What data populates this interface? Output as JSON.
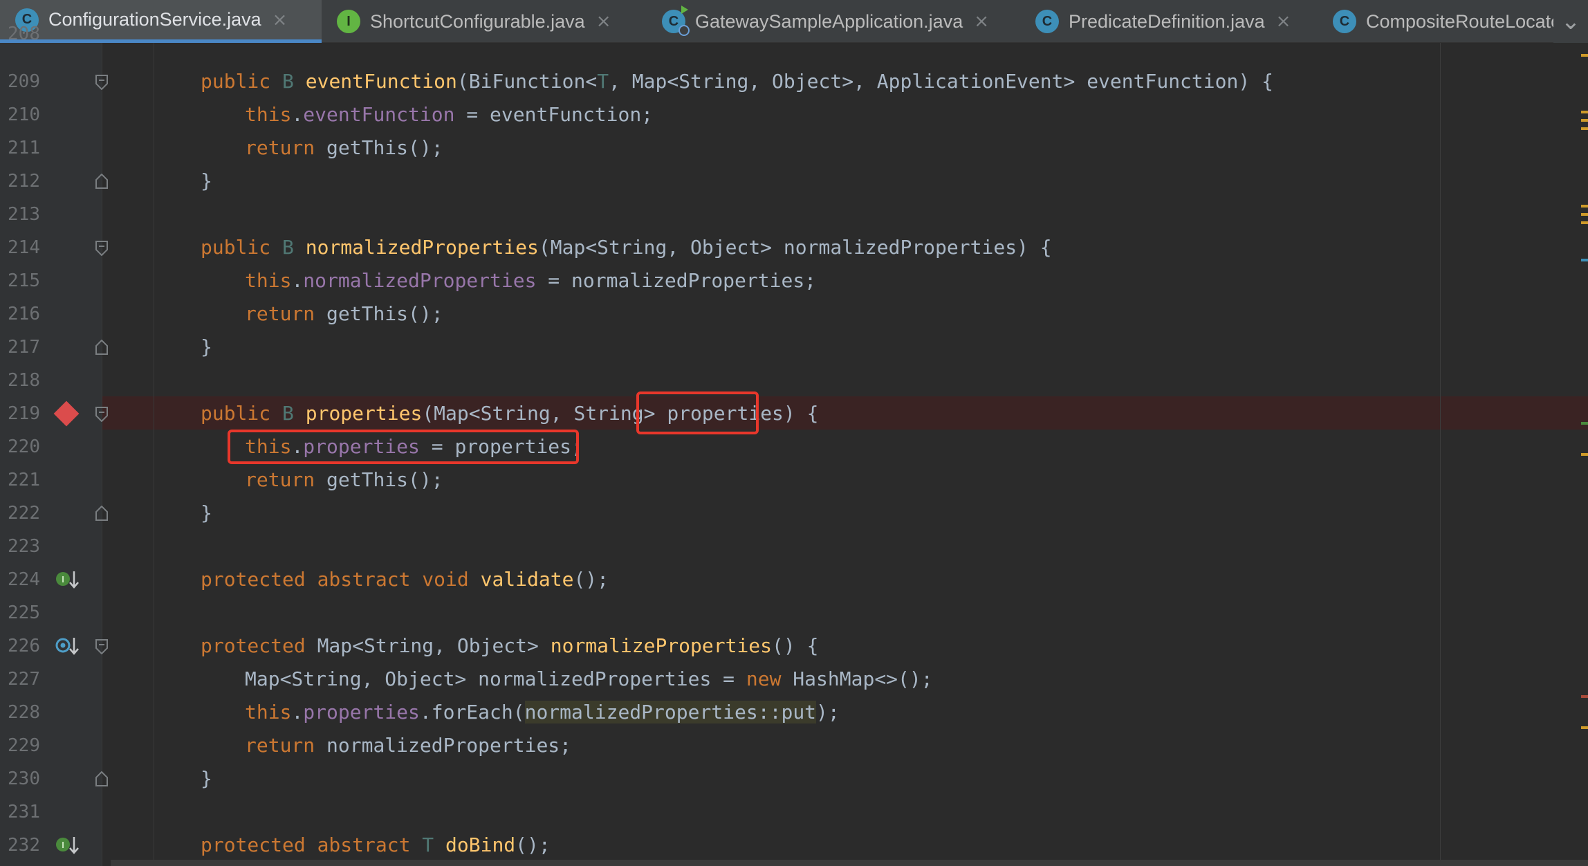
{
  "tabs": [
    {
      "label": "ConfigurationService.java",
      "icon": "class-icon",
      "icon_letter": "C",
      "active": true
    },
    {
      "label": "ShortcutConfigurable.java",
      "icon": "interface-icon",
      "icon_letter": "I",
      "active": false
    },
    {
      "label": "GatewaySampleApplication.java",
      "icon": "runnable-class-icon",
      "icon_letter": "C",
      "active": false
    },
    {
      "label": "PredicateDefinition.java",
      "icon": "class-icon",
      "icon_letter": "C",
      "active": false
    },
    {
      "label": "CompositeRouteLocato",
      "icon": "class-icon",
      "icon_letter": "C",
      "active": false
    }
  ],
  "tab_close_glyph": "×",
  "tab_overflow_glyph": "⌄",
  "editor": {
    "lines": [
      {
        "n": "208"
      },
      {
        "n": "209"
      },
      {
        "n": "210"
      },
      {
        "n": "211"
      },
      {
        "n": "212"
      },
      {
        "n": "213"
      },
      {
        "n": "214"
      },
      {
        "n": "215"
      },
      {
        "n": "216"
      },
      {
        "n": "217"
      },
      {
        "n": "218"
      },
      {
        "n": "219"
      },
      {
        "n": "220"
      },
      {
        "n": "221"
      },
      {
        "n": "222"
      },
      {
        "n": "223"
      },
      {
        "n": "224"
      },
      {
        "n": "225"
      },
      {
        "n": "226"
      },
      {
        "n": "227"
      },
      {
        "n": "228"
      },
      {
        "n": "229"
      },
      {
        "n": "230"
      },
      {
        "n": "231"
      },
      {
        "n": "232"
      }
    ],
    "tokens": {
      "public": "public",
      "protected": "protected",
      "abstract": "abstract",
      "void": "void",
      "return": "return",
      "this": "this",
      "new": "new",
      "B": "B",
      "T": "T",
      "eventFunction": "eventFunction",
      "eventFunction_params_a": "(BiFunction<",
      "eventFunction_params_b": ", Map<String, Object>, ApplicationEvent> eventFunction) {",
      "eventFunction_field": "eventFunction",
      "eventFunction_assign": " = eventFunction;",
      "getThis": " getThis();",
      "close_brace": "}",
      "normalizedProperties": "normalizedProperties",
      "normalizedProperties_params": "(Map<String, Object> normalizedProperties) {",
      "normalizedProperties_field": "normalizedProperties",
      "normalizedProperties_assign": " = normalizedProperties;",
      "properties": "properties",
      "properties_params_a": "(Map<String, String> ",
      "properties_param": "properties",
      "properties_params_b": ") {",
      "properties_field": "properties",
      "properties_assign": " = properties;",
      "validate": "validate",
      "validate_tail": "();",
      "normalizeProperties_ret": " Map<String, Object> ",
      "normalizeProperties": "normalizeProperties",
      "normalizeProperties_tail": "() {",
      "l227_a": "Map<String, Object> normalizedProperties = ",
      "l227_b": " HashMap<>();",
      "l228_a": ".",
      "l228_field": "properties",
      "l228_b": ".forEach(",
      "l228_hl": "normalizedProperties::put",
      "l228_c": ");",
      "l229": " normalizedProperties;",
      "doBind": "doBind",
      "doBind_tail": "();",
      "dot": ".",
      "space": " "
    }
  }
}
